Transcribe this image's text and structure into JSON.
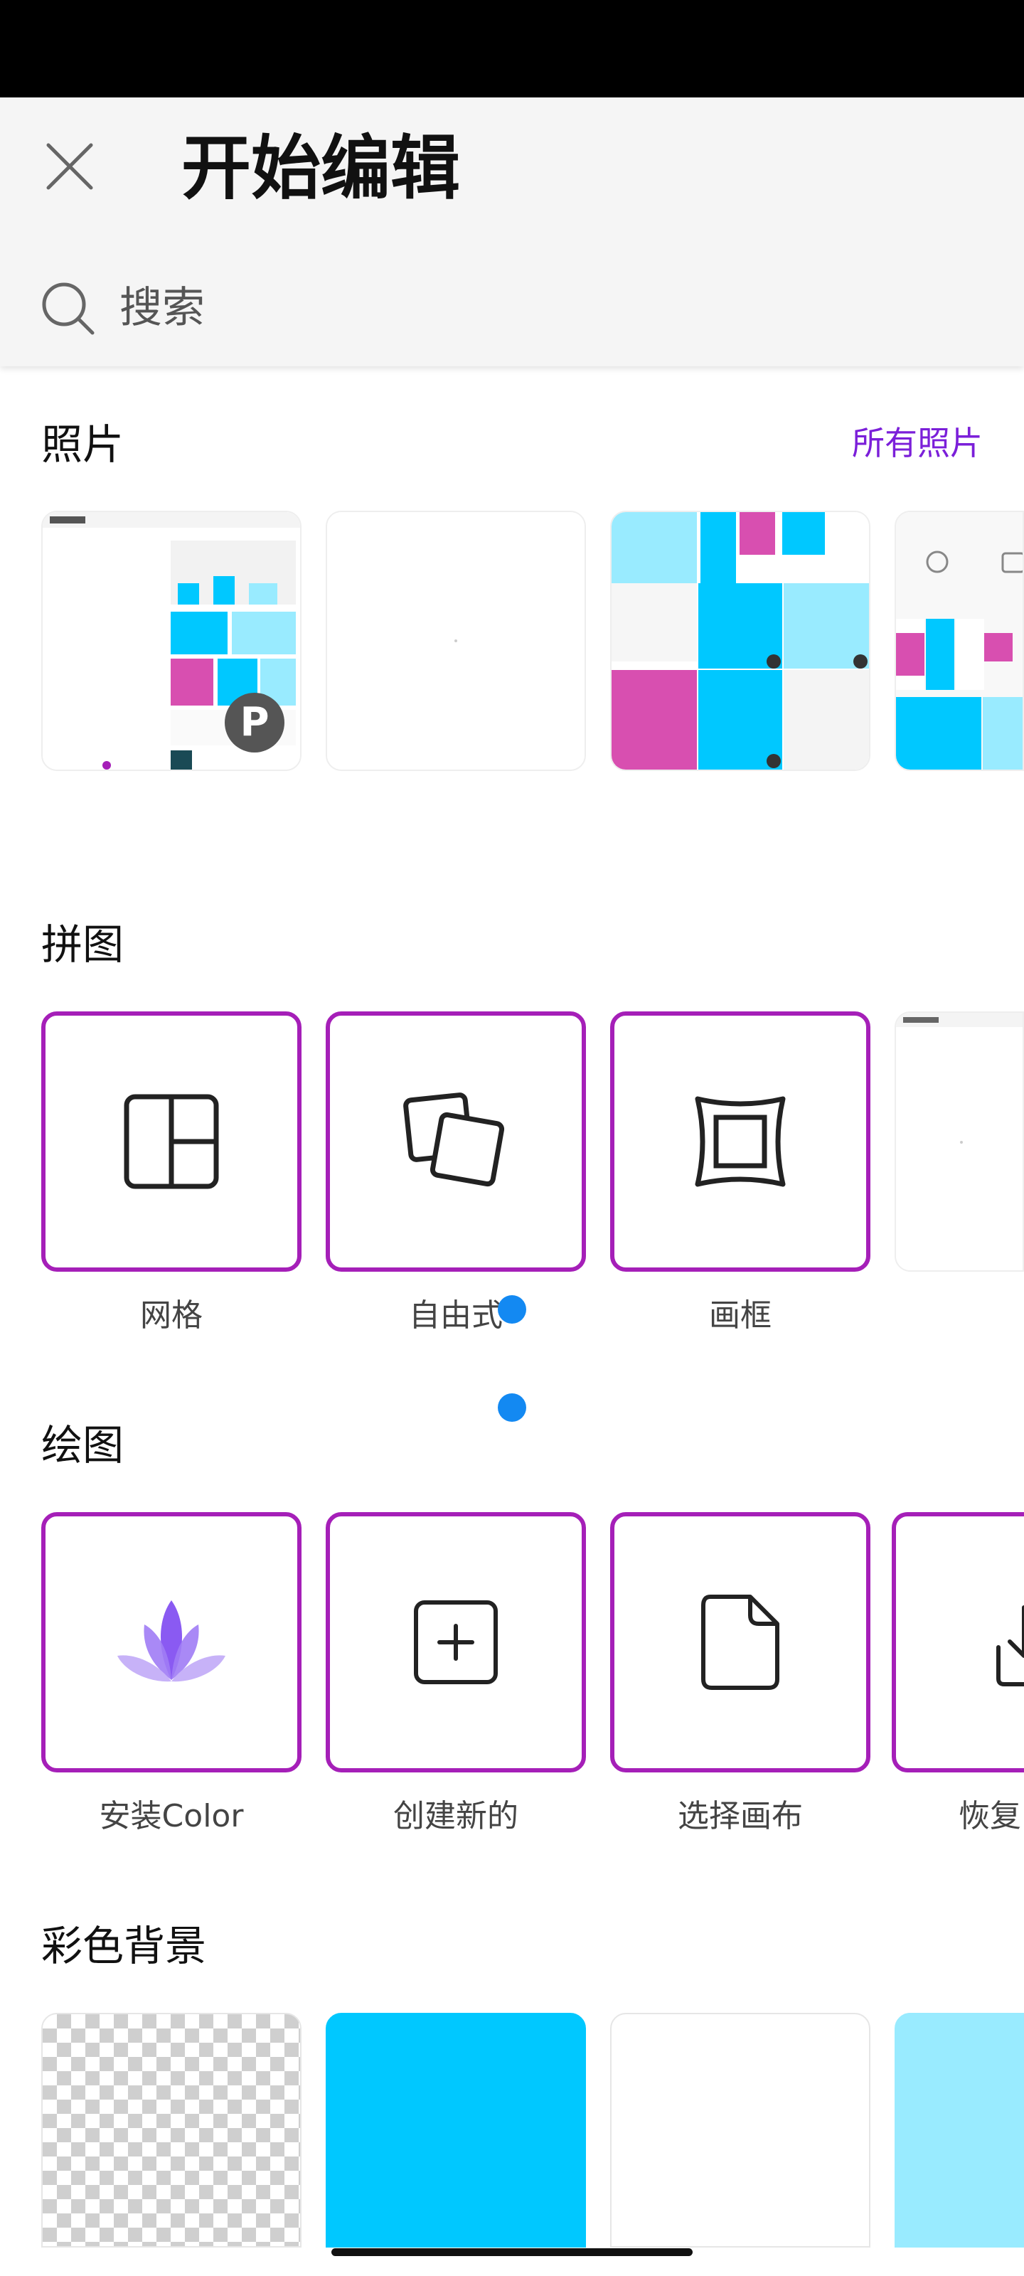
{
  "header": {
    "title": "开始编辑",
    "search_placeholder": "搜索"
  },
  "photos": {
    "title": "照片",
    "see_all": "所有照片",
    "thumbnails": [
      "photo-1",
      "photo-2",
      "photo-3",
      "photo-4"
    ],
    "badge": "P"
  },
  "collage": {
    "title": "拼图",
    "items": [
      {
        "label": "网格",
        "icon": "grid-layout-icon"
      },
      {
        "label": "自由式",
        "icon": "freestyle-icon"
      },
      {
        "label": "画框",
        "icon": "frame-icon"
      }
    ]
  },
  "drawing": {
    "title": "绘图",
    "items": [
      {
        "label": "安装Color",
        "icon": "lotus-icon"
      },
      {
        "label": "创建新的",
        "icon": "add-square-icon"
      },
      {
        "label": "选择画布",
        "icon": "document-icon"
      },
      {
        "label": "恢复",
        "icon": "download-icon"
      }
    ]
  },
  "backgrounds": {
    "title": "彩色背景",
    "colors": [
      "transparent",
      "#00c8ff",
      "#ffffff",
      "#99ebff"
    ]
  },
  "colors": {
    "accent": "#a51fb8",
    "link": "#7b1fd9",
    "dot": "#1389f2",
    "cyan": "#00c8ff",
    "light_cyan": "#99ebff"
  }
}
